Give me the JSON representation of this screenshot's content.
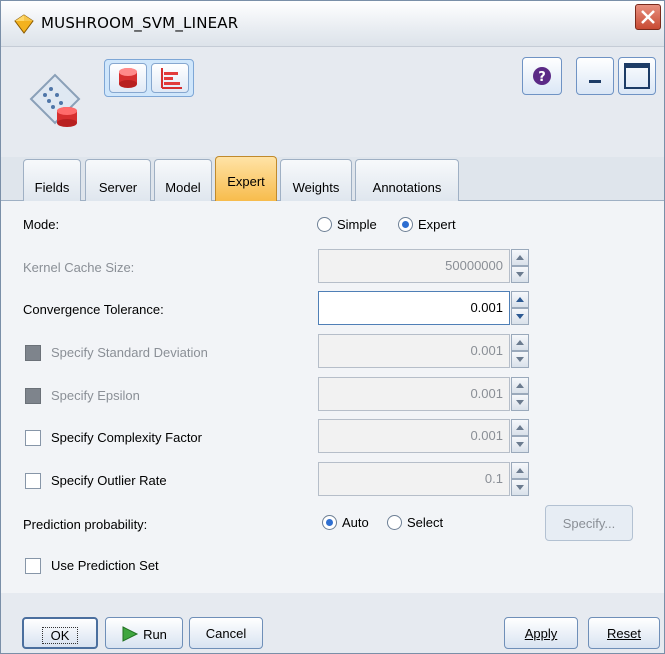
{
  "window": {
    "title": "MUSHROOM_SVM_LINEAR"
  },
  "tabs": [
    {
      "label": "Fields",
      "active": false
    },
    {
      "label": "Server",
      "active": false
    },
    {
      "label": "Model",
      "active": false
    },
    {
      "label": "Expert",
      "active": true
    },
    {
      "label": "Weights",
      "active": false
    },
    {
      "label": "Annotations",
      "active": false
    }
  ],
  "mode": {
    "label": "Mode:",
    "options": [
      "Simple",
      "Expert"
    ],
    "selected": "Expert"
  },
  "params": {
    "kernel_cache": {
      "label": "Kernel Cache Size:",
      "value": "50000000",
      "enabled": false
    },
    "convergence": {
      "label": "Convergence Tolerance:",
      "value": "0.001",
      "enabled": true
    },
    "std_dev": {
      "label": "Specify Standard Deviation",
      "value": "0.001",
      "checked": false,
      "enabled": false
    },
    "epsilon": {
      "label": "Specify Epsilon",
      "value": "0.001",
      "checked": false,
      "enabled": false
    },
    "complexity": {
      "label": "Specify Complexity Factor",
      "value": "0.001",
      "checked": false,
      "enabled": true
    },
    "outlier": {
      "label": "Specify Outlier Rate",
      "value": "0.1",
      "checked": false,
      "enabled": true
    }
  },
  "prediction": {
    "label": "Prediction probability:",
    "options": [
      "Auto",
      "Select"
    ],
    "selected": "Auto",
    "specify_label": "Specify..."
  },
  "prediction_set": {
    "label": "Use Prediction Set",
    "checked": false
  },
  "buttons": {
    "ok": "OK",
    "run": "Run",
    "cancel": "Cancel",
    "apply": "Apply",
    "reset": "Reset"
  },
  "colors": {
    "active_tab": "#f7bb4a",
    "accent": "#2f6fd1",
    "close": "#c84a33"
  }
}
